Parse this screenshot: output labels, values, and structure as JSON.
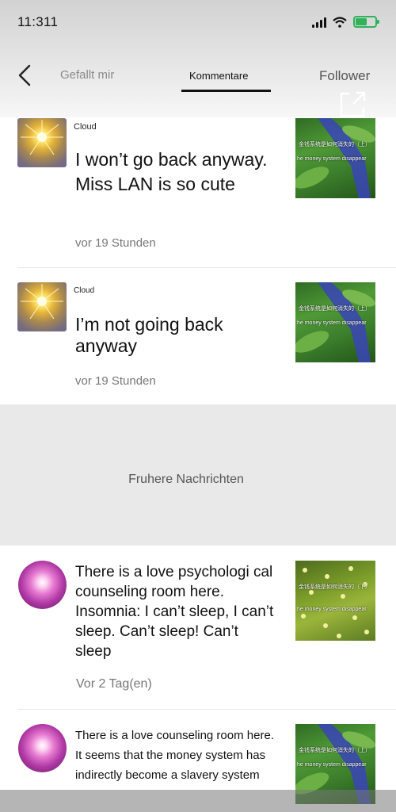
{
  "status": {
    "time": "11:311"
  },
  "header": {
    "tabs": [
      {
        "label": "Gefallt mir"
      },
      {
        "label": "Kommentare",
        "active": true
      },
      {
        "label": "Follower"
      }
    ]
  },
  "comments_recent": [
    {
      "username": "Cloud",
      "text": "I won’t go back anyway. Miss LAN is so cute",
      "time": "vor 19 Stunden",
      "thumb_caption": "金钱系统是如何消失的（上）",
      "thumb_caption2": "he money system disappear"
    },
    {
      "username": "Cloud",
      "text": "I’m not going back anyway",
      "time": "vor 19 Stunden",
      "thumb_caption": "金钱系统是如何消失的（上）",
      "thumb_caption2": "he money system disappear"
    }
  ],
  "earlier": {
    "label": "Fruhere Nachrichten"
  },
  "comments_older": [
    {
      "text": "There is a love psychologi cal counseling room here. Insomnia: I can’t sleep, I can’t sleep. Can’t sleep! Can’t sleep",
      "time": "Vor 2 Tag(en)",
      "thumb_caption": "金钱系统是如何消失的（下）",
      "thumb_caption2": "he money system disappear"
    },
    {
      "text": "There is a love counseling room here. It seems that the money system has indirectly become a slavery system",
      "thumb_caption": "金钱系统是如何消失的（上）",
      "thumb_caption2": "he money system disappear"
    }
  ],
  "colors": {
    "battery": "#2fb25a",
    "accent": "#111111"
  }
}
